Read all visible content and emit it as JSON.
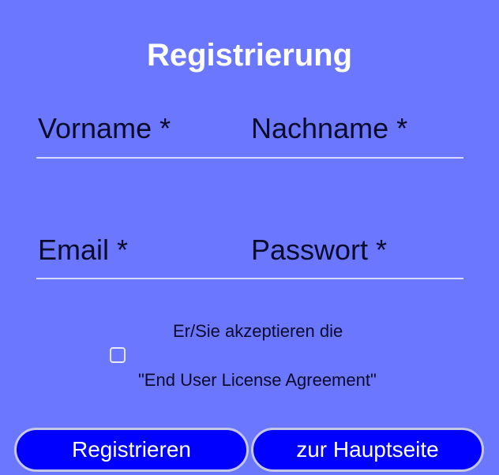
{
  "form": {
    "title": "Registrierung",
    "fields": {
      "first_name_label": "Vorname *",
      "last_name_label": "Nachname *",
      "email_label": "Email *",
      "password_label": "Passwort *"
    },
    "eula": {
      "line1": "Er/Sie akzeptieren die",
      "line2": "\"End User License Agreement\"",
      "checked": false
    },
    "buttons": {
      "register": "Registrieren",
      "home": "zur Hauptseite"
    }
  },
  "colors": {
    "background": "#6b77ff",
    "button": "#0000ff",
    "underline": "#d7d9ff"
  }
}
